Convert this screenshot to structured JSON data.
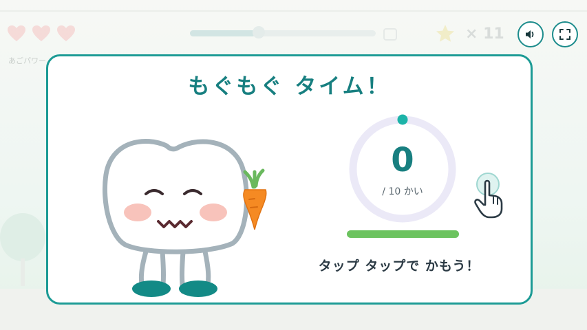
{
  "hud": {
    "hearts": [
      {
        "icon": "heart-icon"
      },
      {
        "icon": "heart-icon"
      },
      {
        "icon": "heart-icon"
      }
    ],
    "power_label": "あごパワー",
    "level_progress": 0.35,
    "star_count": "× 11",
    "sound_button_icon": "speaker-icon",
    "fullscreen_button_icon": "fullscreen-icon"
  },
  "modal": {
    "title": "もぐもぐ タイム！",
    "chew_count": "0",
    "chew_goal": "/ 10 かい",
    "chew_progress": 0,
    "energy_level": 1.0,
    "instruction": "タップ タップで かもう！",
    "food_icon": "carrot-icon",
    "tap_hint_icon": "tap-hand-icon"
  },
  "colors": {
    "accent": "#1c9b95",
    "title": "#177f80",
    "ring": "#ebe9f7",
    "ring_dot": "#1cb3a8",
    "energy": "#6cc35f",
    "tooth_outline": "#a4b2ba",
    "feet": "#138a86",
    "cheeks": "#f6c1b9"
  }
}
